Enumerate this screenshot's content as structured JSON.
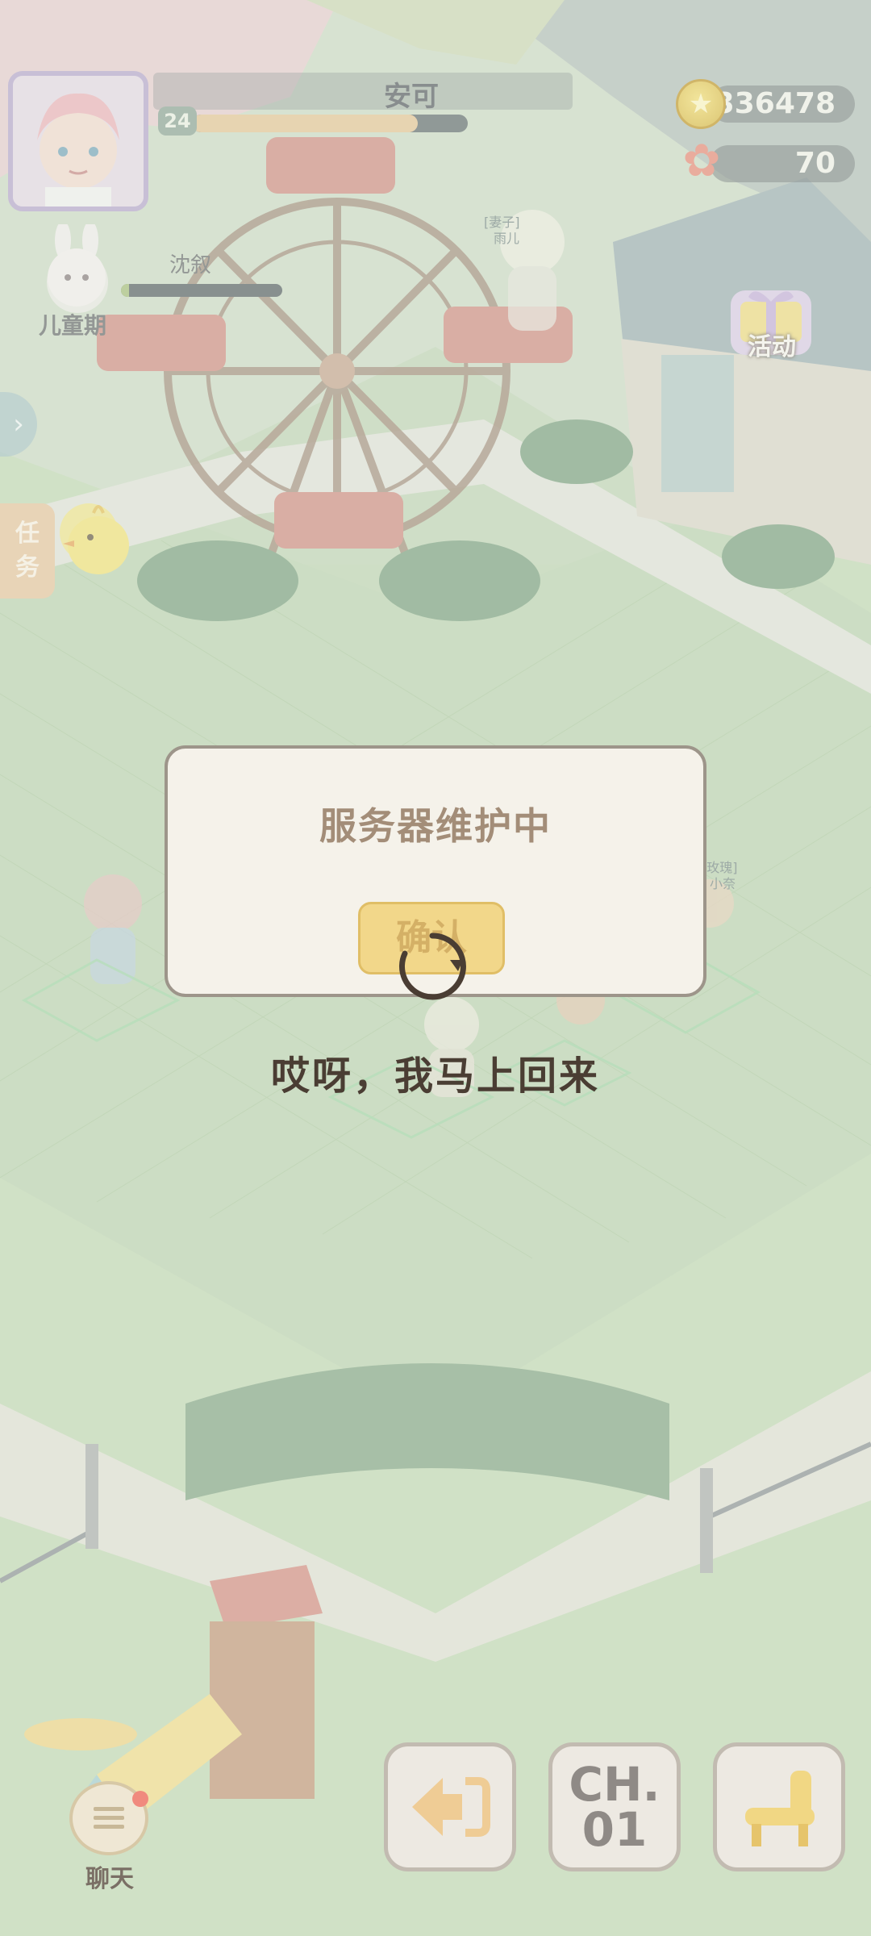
{
  "player": {
    "name": "安可",
    "level": "24",
    "exp_progress": 0.82
  },
  "currency": {
    "coins": "336478",
    "flowers": "70",
    "coin_icon": "star-coin-icon",
    "flower_icon": "flower-icon"
  },
  "partner": {
    "name": "沈叙",
    "stage": "儿童期",
    "bond_progress": 0.05
  },
  "sidebar": {
    "task_tab": [
      "任",
      "务"
    ]
  },
  "event": {
    "label": "活动"
  },
  "map_tags": {
    "tag1": "[妻子]",
    "tag2": "雨儿",
    "tag3": "[玫瑰]",
    "tag4": "小奈"
  },
  "dialog": {
    "title": "服务器维护中",
    "confirm_label": "确认"
  },
  "loading": {
    "message": "哎呀，我马上回来"
  },
  "bottom_bar": {
    "chat_label": "聊天",
    "chapter_line1": "CH.",
    "chapter_line2": "01"
  },
  "colors": {
    "grass": "#c4dab8",
    "dialog_bg": "#f5f2ea",
    "confirm_bg": "#f2d78a",
    "accent_text": "#a38d78"
  }
}
